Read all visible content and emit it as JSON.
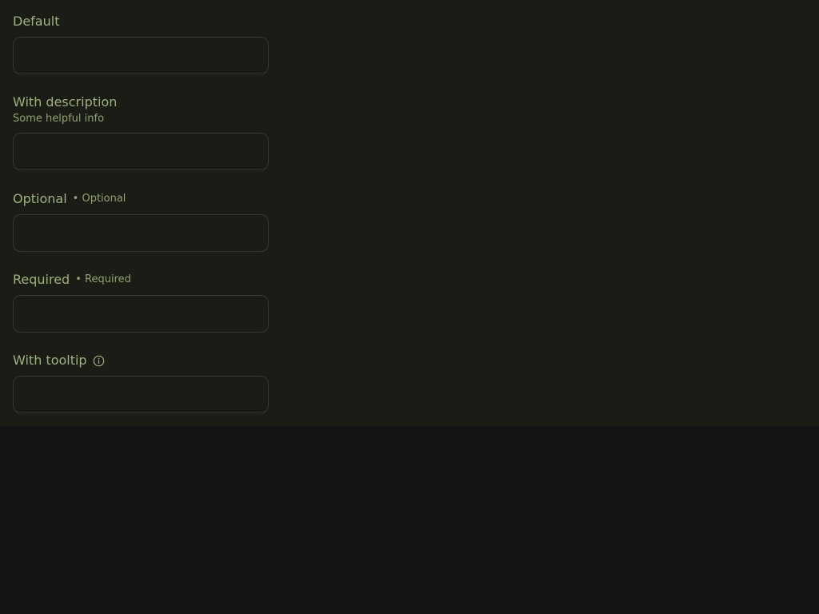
{
  "fields": {
    "default": {
      "label": "Default",
      "value": "",
      "placeholder": ""
    },
    "description": {
      "label": "With description",
      "description": "Some helpful info",
      "value": "",
      "placeholder": ""
    },
    "optional": {
      "label": "Optional",
      "badge": "• Optional",
      "value": "",
      "placeholder": ""
    },
    "required": {
      "label": "Required",
      "badge": "• Required",
      "value": "",
      "placeholder": ""
    },
    "tooltip": {
      "label": "With tooltip",
      "icon": "info-icon",
      "value": "",
      "placeholder": ""
    }
  },
  "colors": {
    "panel_background": "#1b1c15",
    "page_background": "#131313",
    "label": "#9cb27c",
    "secondary_text": "#8fa46f",
    "input_border": "#36372f"
  }
}
